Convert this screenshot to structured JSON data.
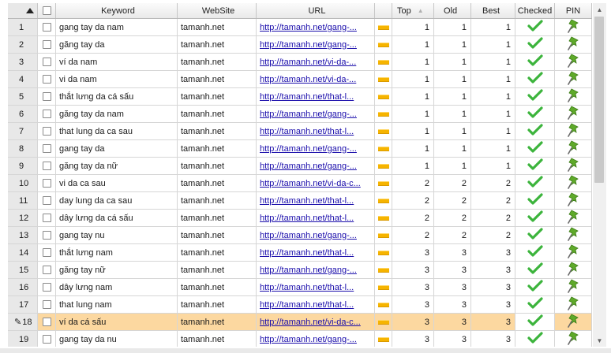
{
  "grid": {
    "headers": {
      "keyword": "Keyword",
      "website": "WebSite",
      "url": "URL",
      "top": "Top",
      "old": "Old",
      "best": "Best",
      "checked": "Checked",
      "pin": "PIN"
    },
    "rows": [
      {
        "num": "1",
        "keyword": "gang tay da nam",
        "website": "tamanh.net",
        "url": "http://tamanh.net/gang-...",
        "top": "1",
        "old": "1",
        "best": "1"
      },
      {
        "num": "2",
        "keyword": "găng tay da",
        "website": "tamanh.net",
        "url": "http://tamanh.net/gang-...",
        "top": "1",
        "old": "1",
        "best": "1"
      },
      {
        "num": "3",
        "keyword": "ví da nam",
        "website": "tamanh.net",
        "url": "http://tamanh.net/vi-da-...",
        "top": "1",
        "old": "1",
        "best": "1"
      },
      {
        "num": "4",
        "keyword": "vi da nam",
        "website": "tamanh.net",
        "url": "http://tamanh.net/vi-da-...",
        "top": "1",
        "old": "1",
        "best": "1"
      },
      {
        "num": "5",
        "keyword": "thắt lưng da cá sấu",
        "website": "tamanh.net",
        "url": "http://tamanh.net/that-l...",
        "top": "1",
        "old": "1",
        "best": "1"
      },
      {
        "num": "6",
        "keyword": "găng tay da nam",
        "website": "tamanh.net",
        "url": "http://tamanh.net/gang-...",
        "top": "1",
        "old": "1",
        "best": "1"
      },
      {
        "num": "7",
        "keyword": "that lung da ca sau",
        "website": "tamanh.net",
        "url": "http://tamanh.net/that-l...",
        "top": "1",
        "old": "1",
        "best": "1"
      },
      {
        "num": "8",
        "keyword": "gang tay da",
        "website": "tamanh.net",
        "url": "http://tamanh.net/gang-...",
        "top": "1",
        "old": "1",
        "best": "1"
      },
      {
        "num": "9",
        "keyword": "găng tay da nữ",
        "website": "tamanh.net",
        "url": "http://tamanh.net/gang-...",
        "top": "1",
        "old": "1",
        "best": "1"
      },
      {
        "num": "10",
        "keyword": "vi da ca sau",
        "website": "tamanh.net",
        "url": "http://tamanh.net/vi-da-c...",
        "top": "2",
        "old": "2",
        "best": "2"
      },
      {
        "num": "11",
        "keyword": "day lung da ca sau",
        "website": "tamanh.net",
        "url": "http://tamanh.net/that-l...",
        "top": "2",
        "old": "2",
        "best": "2"
      },
      {
        "num": "12",
        "keyword": "dây lưng da cá sấu",
        "website": "tamanh.net",
        "url": "http://tamanh.net/that-l...",
        "top": "2",
        "old": "2",
        "best": "2"
      },
      {
        "num": "13",
        "keyword": "gang tay nu",
        "website": "tamanh.net",
        "url": "http://tamanh.net/gang-...",
        "top": "2",
        "old": "2",
        "best": "2"
      },
      {
        "num": "14",
        "keyword": "thắt lưng nam",
        "website": "tamanh.net",
        "url": "http://tamanh.net/that-l...",
        "top": "3",
        "old": "3",
        "best": "3"
      },
      {
        "num": "15",
        "keyword": "găng tay nữ",
        "website": "tamanh.net",
        "url": "http://tamanh.net/gang-...",
        "top": "3",
        "old": "3",
        "best": "3"
      },
      {
        "num": "16",
        "keyword": "dây lưng nam",
        "website": "tamanh.net",
        "url": "http://tamanh.net/that-l...",
        "top": "3",
        "old": "3",
        "best": "3"
      },
      {
        "num": "17",
        "keyword": "that lung nam",
        "website": "tamanh.net",
        "url": "http://tamanh.net/that-l...",
        "top": "3",
        "old": "3",
        "best": "3"
      },
      {
        "num": "18",
        "keyword": "ví da cá sấu",
        "website": "tamanh.net",
        "url": "http://tamanh.net/vi-da-c...",
        "top": "3",
        "old": "3",
        "best": "3"
      },
      {
        "num": "19",
        "keyword": "gang tay da nu",
        "website": "tamanh.net",
        "url": "http://tamanh.net/gang-...",
        "top": "3",
        "old": "3",
        "best": "3"
      }
    ],
    "selected_row": "18",
    "edit_indicator": "✎",
    "icons": {
      "sort": "sort-triangle-icon",
      "checked": "green-checkmark-icon",
      "pin": "green-pushpin-icon",
      "rank_bar": "orange-rank-bar-icon"
    },
    "colors": {
      "selected_row": "#fcd8a0",
      "link": "#1a0dab",
      "check": "#3cb43c",
      "pin": "#5faa2a",
      "bar": "#f6b400"
    },
    "sort_arrow": "▲",
    "scroll_up": "▲",
    "scroll_down": "▼"
  }
}
